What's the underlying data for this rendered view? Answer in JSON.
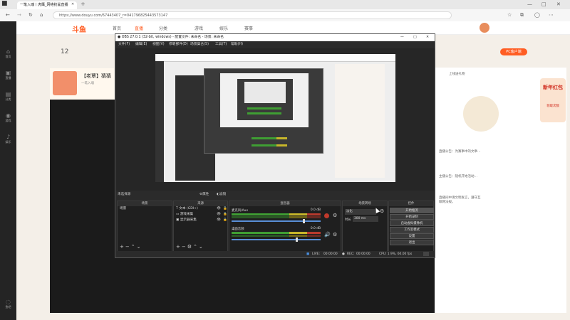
{
  "browser": {
    "tab_title": "一笔入魂丨虎鹰_网络抢鲨直播",
    "new_tab": "+",
    "url": "https://www.douyu.com/67443407_r=041796825443573147",
    "window_controls": [
      "—",
      "□",
      "✕"
    ]
  },
  "sidebar": {
    "items": [
      {
        "label": "首页",
        "icon": "home-icon"
      },
      {
        "label": "直播",
        "icon": "live-icon"
      },
      {
        "label": "分类",
        "icon": "category-icon"
      },
      {
        "label": "游戏",
        "icon": "game-icon"
      },
      {
        "label": "娱乐",
        "icon": "entertainment-icon"
      }
    ],
    "bottom_label": "鱼吧"
  },
  "site": {
    "logo": "斗鱼",
    "nav": [
      "首页",
      "直播",
      "分类",
      "游戏",
      "娱乐",
      "赛事"
    ],
    "level_number": "12",
    "room_title": "【老覃】猜猜",
    "room_sub": "一笔入魂",
    "pc_client": "PC客户端",
    "promo": "新年红包",
    "promo_sub": "领取次数",
    "right_texts": [
      "上线送礼物",
      "直播公告：为赛事中的文章…",
      "主播公告：随机开始活动…",
      "直播间中请文明发言，遵守互联网法规。"
    ]
  },
  "obs": {
    "title": "OBS 27.0.1 (32-bit, windows) - 配置文件: 未命名 - 场景: 未命名",
    "menu": [
      "文件(F)",
      "编辑(E)",
      "视图(V)",
      "停靠部件(D)",
      "场景集合(S)",
      "工具(T)",
      "帮助(H)"
    ],
    "scene_bar_label": "未选择源",
    "scene_bar_buttons": [
      "属性",
      "滤镜"
    ],
    "docks": {
      "scenes": {
        "title": "场景",
        "items": [
          "场景"
        ]
      },
      "sources": {
        "title": "来源",
        "items": [
          {
            "label": "文本 (GDI+)",
            "icon": "text-icon"
          },
          {
            "label": "游戏采集",
            "icon": "game-capture-icon"
          },
          {
            "label": "显示器采集",
            "icon": "monitor-icon"
          }
        ]
      },
      "mixer": {
        "title": "混音器",
        "tracks": [
          {
            "name": "麦克风/Aux",
            "db": "0.0 dB",
            "level": 0.7,
            "volume": 0.8
          },
          {
            "name": "桌面音频",
            "db": "0.0 dB",
            "level": 0.55,
            "volume": 0.6
          }
        ]
      },
      "transitions": {
        "title": "场景转场",
        "type": "淡化",
        "duration_label": "时长",
        "duration": "300 ms"
      },
      "controls": {
        "title": "控件",
        "buttons": [
          "开始推流",
          "开始录制",
          "启动虚拟摄像机",
          "工作室模式",
          "设置",
          "退出"
        ]
      }
    },
    "status": {
      "live_label": "LIVE:",
      "live_time": "00:00:00",
      "rec_label": "REC:",
      "rec_time": "00:00:00",
      "cpu": "CPU: 1.9%, 60.00 fps"
    }
  },
  "colors": {
    "accent": "#ff5d23",
    "obs_bg": "#2b2b2b",
    "obs_dock": "#1f1f1f",
    "sidebar": "#242424"
  }
}
